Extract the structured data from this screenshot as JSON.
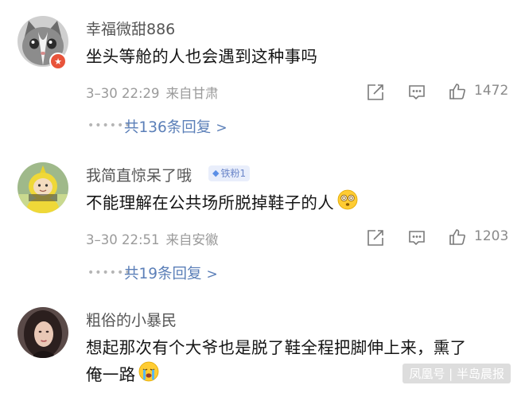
{
  "comments": [
    {
      "username": "幸福微甜886",
      "text": "坐头等舱的人也会遇到这种事吗",
      "time": "3–30 22:29",
      "location": "来自甘肃",
      "likes": "1472",
      "replies": "共136条回复",
      "avatar": "cat-avatar"
    },
    {
      "username": "我简直惊呆了哦",
      "badge": "铁粉1",
      "text": "不能理解在公共场所脱掉鞋子的人",
      "emoji": "shocked-face-emoji",
      "time": "3–30 22:51",
      "location": "来自安徽",
      "likes": "1203",
      "replies": "共19条回复",
      "avatar": "teletubby-avatar"
    },
    {
      "username": "粗俗的小暴民",
      "text_line1": "想起那次有个大爷也是脱了鞋全程把脚伸上来，熏了",
      "text_line2": "俺一路",
      "emoji": "crying-face-emoji",
      "avatar": "woman-portrait-avatar"
    }
  ],
  "watermark": "凤凰号 | 半岛晨报",
  "dots": "••••••",
  "chevron": ">",
  "avatar_badge": "★",
  "colors": {
    "link": "#5b7fb8",
    "meta": "#9a9a9a",
    "badge_bg": "#e9eefb"
  }
}
